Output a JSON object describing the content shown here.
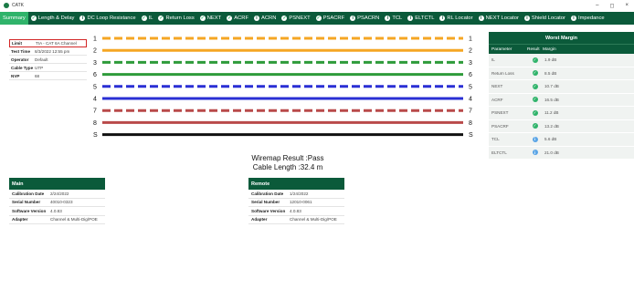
{
  "window": {
    "title": "CATK",
    "controls": [
      "–",
      "◻",
      "×"
    ]
  },
  "tabs": [
    {
      "label": "Summary",
      "icon": "none",
      "active": true
    },
    {
      "label": "Length & Delay",
      "icon": "check"
    },
    {
      "label": "DC Loop Resistance",
      "icon": "info"
    },
    {
      "label": "IL",
      "icon": "check"
    },
    {
      "label": "Return Loss",
      "icon": "check"
    },
    {
      "label": "NEXT",
      "icon": "check"
    },
    {
      "label": "ACRF",
      "icon": "check"
    },
    {
      "label": "ACRN",
      "icon": "info"
    },
    {
      "label": "PSNEXT",
      "icon": "check"
    },
    {
      "label": "PSACRF",
      "icon": "check"
    },
    {
      "label": "PSACRN",
      "icon": "info"
    },
    {
      "label": "TCL",
      "icon": "info"
    },
    {
      "label": "ELTCTL",
      "icon": "info"
    },
    {
      "label": "RL Locator",
      "icon": "info"
    },
    {
      "label": "NEXT Locator",
      "icon": "info"
    },
    {
      "label": "Shield Locator",
      "icon": "info"
    },
    {
      "label": "Impedance",
      "icon": "info"
    }
  ],
  "info": {
    "limit_label": "Limit",
    "limit_value": "TIA - CAT 6A Channel",
    "time_label": "Test Time",
    "time_value": "8/3/2022 12:55 pm",
    "operator_label": "Operator",
    "operator_value": "Default",
    "cable_label": "Cable Type",
    "cable_value": "UTP",
    "nvp_label": "NVP",
    "nvp_value": "68"
  },
  "wiremap": {
    "pins": [
      {
        "left": "1",
        "right": "1",
        "color": "#f5a623",
        "dashed": true
      },
      {
        "left": "2",
        "right": "2",
        "color": "#f5a623",
        "dashed": false
      },
      {
        "left": "3",
        "right": "3",
        "color": "#2e9b3a",
        "dashed": true
      },
      {
        "left": "6",
        "right": "6",
        "color": "#2e9b3a",
        "dashed": false
      },
      {
        "left": "5",
        "right": "5",
        "color": "#2a2fd4",
        "dashed": true
      },
      {
        "left": "4",
        "right": "4",
        "color": "#2a2fd4",
        "dashed": false
      },
      {
        "left": "7",
        "right": "7",
        "color": "#b94a4a",
        "dashed": true
      },
      {
        "left": "8",
        "right": "8",
        "color": "#b94a4a",
        "dashed": false
      },
      {
        "left": "S",
        "right": "S",
        "color": "#111111",
        "dashed": false
      }
    ]
  },
  "result": {
    "line1": "Wiremap Result :Pass",
    "line2": "Cable Length :32.4 m"
  },
  "worst_margin": {
    "title": "Worst Margin",
    "col_param": "Parameter",
    "col_result": "Result",
    "col_margin": "Margin",
    "rows": [
      {
        "param": "IL",
        "status": "ok",
        "margin": "1.9 dB"
      },
      {
        "param": "Return Loss",
        "status": "ok",
        "margin": "8.5 dB"
      },
      {
        "param": "NEXT",
        "status": "ok",
        "margin": "10.7 dB"
      },
      {
        "param": "ACRF",
        "status": "ok",
        "margin": "16.5 dB"
      },
      {
        "param": "PSNEXT",
        "status": "ok",
        "margin": "11.2 dB"
      },
      {
        "param": "PSACRF",
        "status": "ok",
        "margin": "13.2 dB"
      },
      {
        "param": "TCL",
        "status": "info",
        "margin": "5.6 dB"
      },
      {
        "param": "ELTCTL",
        "status": "info",
        "margin": "21.0 dB"
      }
    ]
  },
  "main_unit": {
    "title": "Main",
    "cal_label": "Calibration Date",
    "cal_value": "2/24/2022",
    "serial_label": "Serial Number",
    "serial_value": "40010-0323",
    "sw_label": "Software Version",
    "sw_value": "4.0.83",
    "adapter_label": "Adapter",
    "adapter_value": "Channel & Multi-Dig/POE"
  },
  "remote_unit": {
    "title": "Remote",
    "cal_label": "Calibration Date",
    "cal_value": "1/24/2022",
    "serial_label": "Serial Number",
    "serial_value": "12010-0061",
    "sw_label": "Software Version",
    "sw_value": "4.0.83",
    "adapter_label": "Adapter",
    "adapter_value": "Channel & Multi-Dig/POE"
  }
}
